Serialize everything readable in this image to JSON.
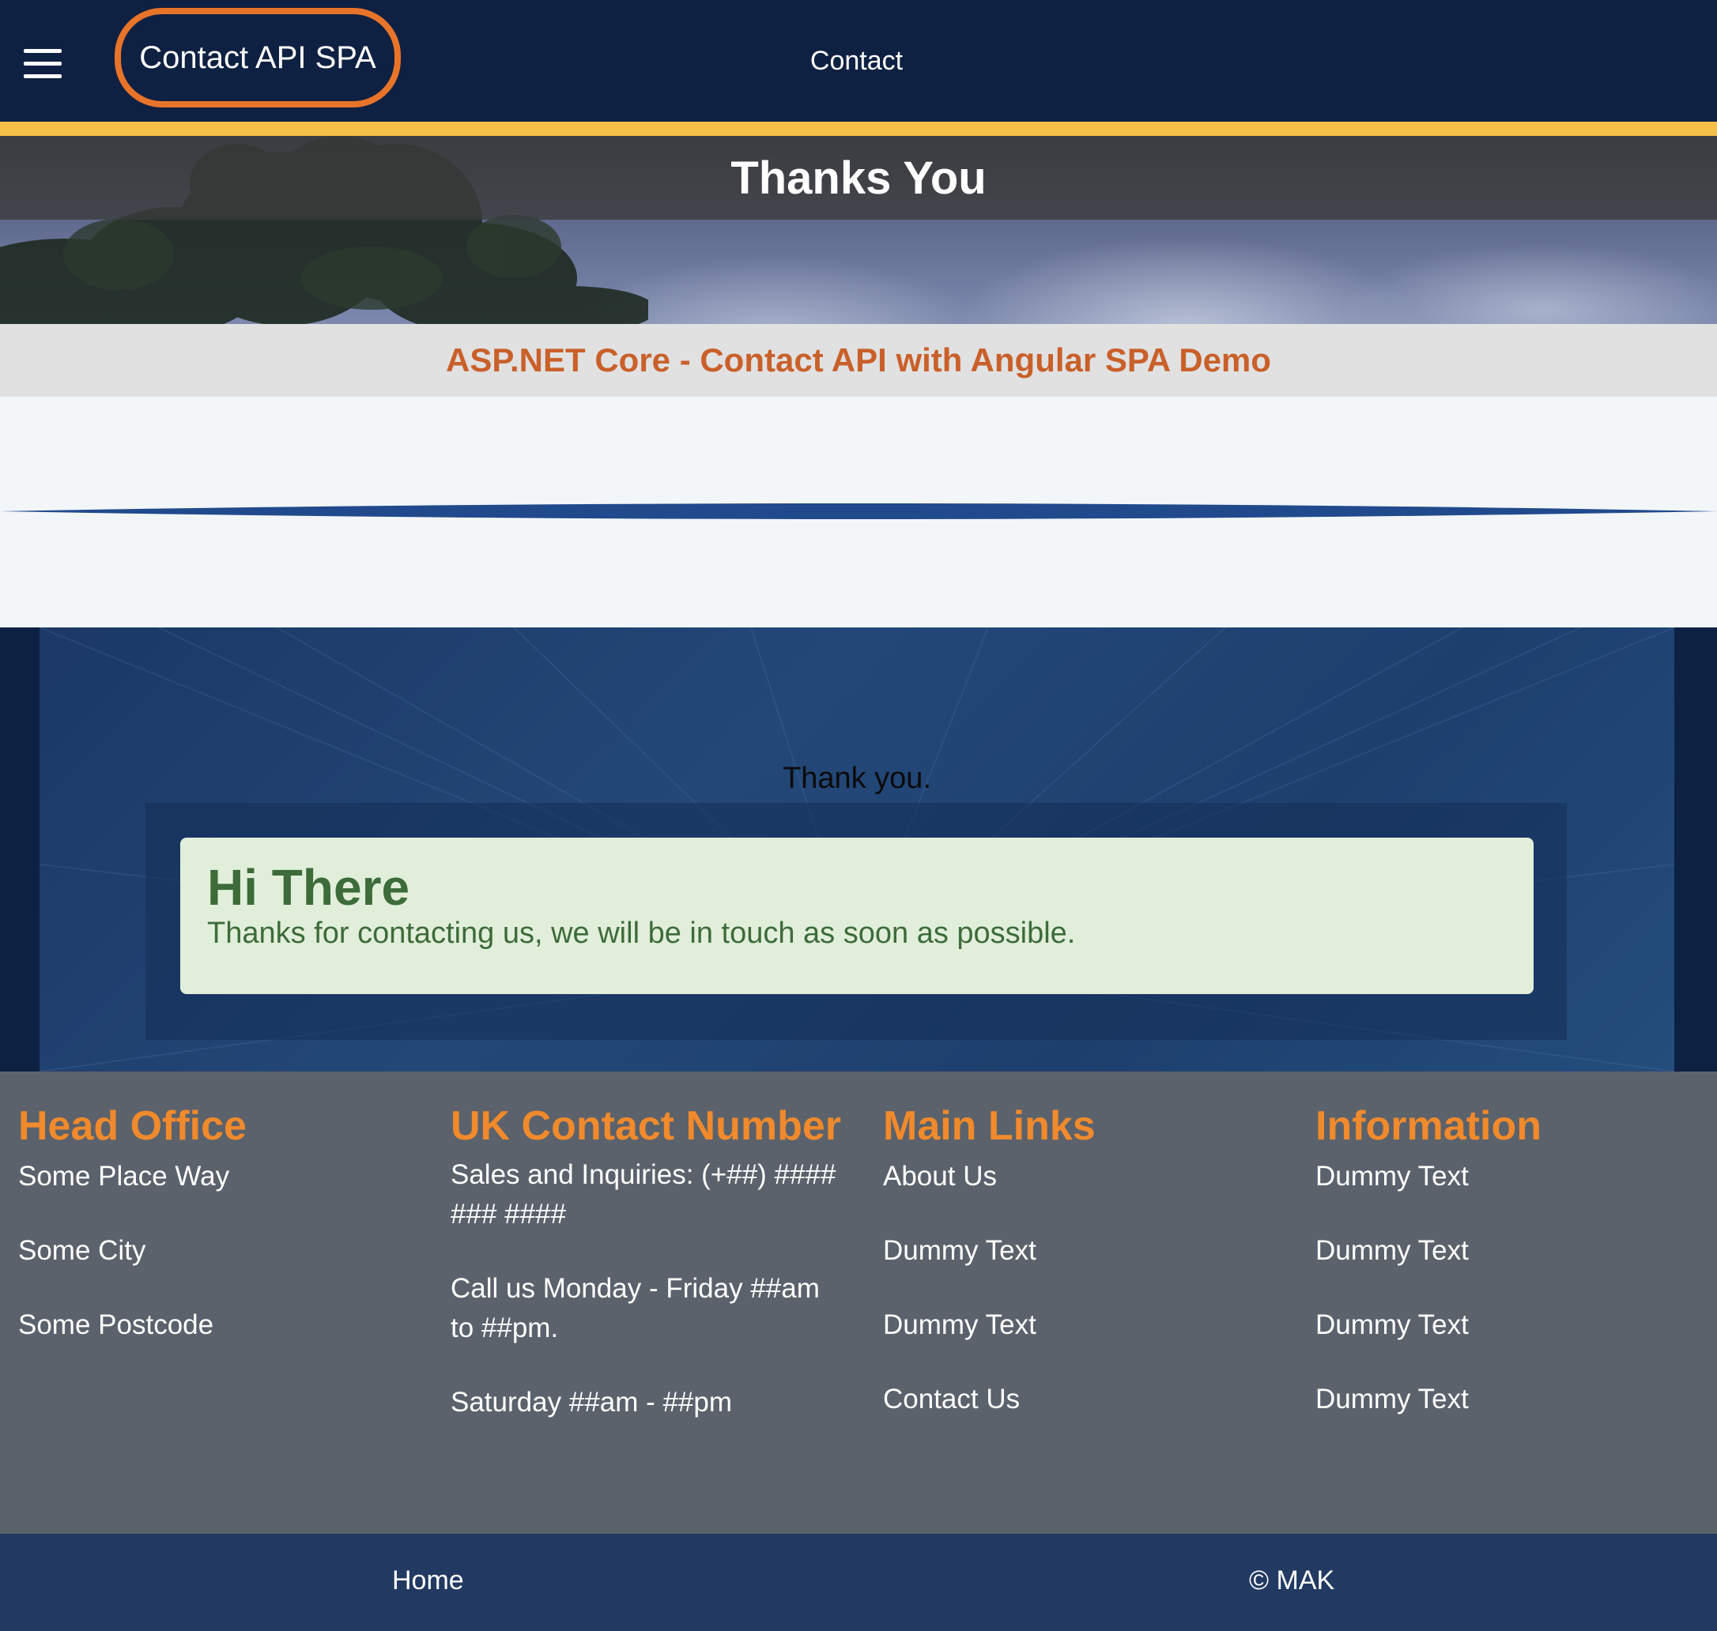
{
  "navbar": {
    "brand": "Contact API SPA",
    "links": [
      "Contact"
    ],
    "menu_icon": "hamburger-menu-icon",
    "colors": {
      "background": "#0f2142",
      "accent_border": "#e8742a",
      "underline": "#f5c045"
    }
  },
  "hero": {
    "title": "Thanks You"
  },
  "subtitle": "ASP.NET Core - Contact API with Angular SPA Demo",
  "content": {
    "thank_text": "Thank you.",
    "alert": {
      "title": "Hi There",
      "message": "Thanks for contacting us, we will be in touch as soon as possible.",
      "colors": {
        "background": "#e1efda",
        "text": "#3d6b3a"
      }
    }
  },
  "footer": {
    "columns": [
      {
        "heading": "Head Office",
        "items": [
          "Some Place Way",
          "Some City",
          "Some Postcode"
        ]
      },
      {
        "heading": "UK Contact Number",
        "items": [
          "Sales and Inquiries: (+##) #### ### ####",
          "Call us Monday - Friday ##am to ##pm.",
          "Saturday ##am - ##pm"
        ]
      },
      {
        "heading": "Main Links",
        "items": [
          "About Us",
          "Dummy Text",
          "Dummy Text",
          "Contact Us"
        ]
      },
      {
        "heading": "Information",
        "items": [
          "Dummy Text",
          "Dummy Text",
          "Dummy Text",
          "Dummy Text"
        ]
      }
    ],
    "colors": {
      "heading": "#f08a2c",
      "background": "#5b626b"
    }
  },
  "bottom_bar": {
    "home": "Home",
    "copyright": "© MAK"
  }
}
